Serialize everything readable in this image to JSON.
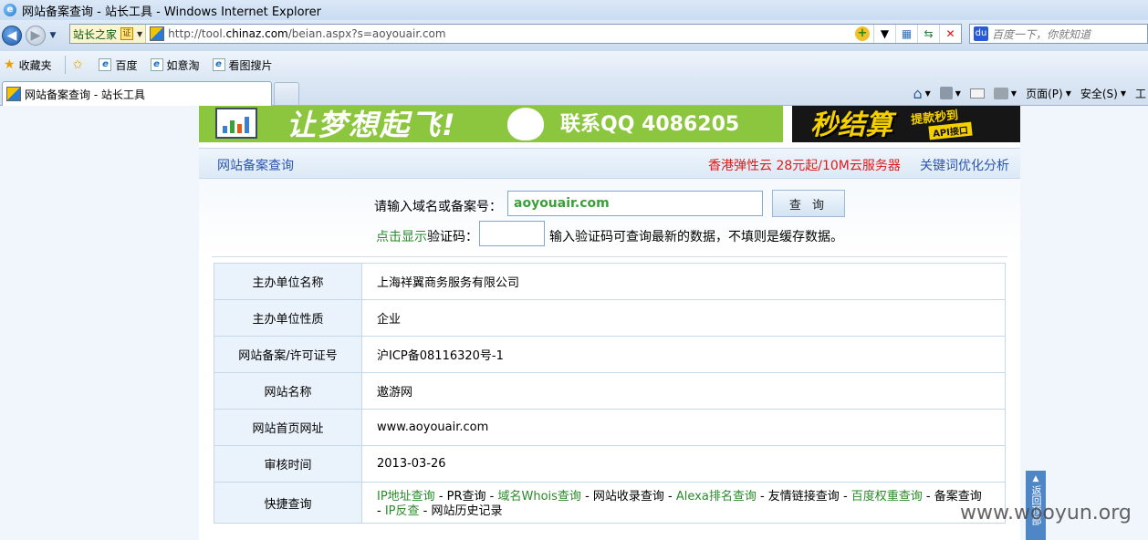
{
  "window": {
    "title": "网站备案查询 - 站长工具 - Windows Internet Explorer"
  },
  "address": {
    "badge": "站长之家",
    "cert": "证",
    "url_prefix": "http://tool.",
    "url_domain": "chinaz.com",
    "url_path": "/beian.aspx?s=aoyouair.com"
  },
  "search": {
    "placeholder": "百度一下，你就知道"
  },
  "favorites": {
    "label": "收藏夹",
    "items": [
      "百度",
      "如意淘",
      "看图搜片"
    ]
  },
  "tab": {
    "label": "网站备案查询 - 站长工具"
  },
  "commands": {
    "page": "页面(P)",
    "safety": "安全(S)",
    "tools": "工"
  },
  "banner": {
    "slogan": "让梦想起飞!",
    "qq": "联系QQ 4086205",
    "right_big": "秒结算",
    "right_tag1": "提款秒到",
    "right_tag2": "API接口"
  },
  "header": {
    "title": "网站备案查询",
    "promo": "香港弹性云 28元起/10M云服务器",
    "seo": "关键词优化分析"
  },
  "form": {
    "label": "请输入域名或备案号：",
    "value": "aoyouair.com",
    "button": "查 询",
    "captcha_link": "点击显示",
    "captcha_label": "验证码：",
    "captcha_hint": "输入验证码可查询最新的数据，不填则是缓存数据。"
  },
  "result": [
    {
      "k": "主办单位名称",
      "v": "上海祥翼商务服务有限公司"
    },
    {
      "k": "主办单位性质",
      "v": "企业"
    },
    {
      "k": "网站备案/许可证号",
      "v": "沪ICP备08116320号-1"
    },
    {
      "k": "网站名称",
      "v": "遨游网"
    },
    {
      "k": "网站首页网址",
      "v": "www.aoyouair.com"
    },
    {
      "k": "审核时间",
      "v": "2013-03-26"
    }
  ],
  "quick": {
    "label": "快捷查询",
    "ip": "IP地址查询",
    "pr": "PR查询",
    "whois": "域名Whois查询",
    "index": "网站收录查询",
    "alexa": "Alexa排名查询",
    "links": "友情链接查询",
    "baidu": "百度权重查询",
    "beian": "备案查询",
    "reverse": "IP反查",
    "history": "网站历史记录",
    "sep": " - "
  },
  "back_top": "返回顶部",
  "watermark": "www.wooyun.org"
}
